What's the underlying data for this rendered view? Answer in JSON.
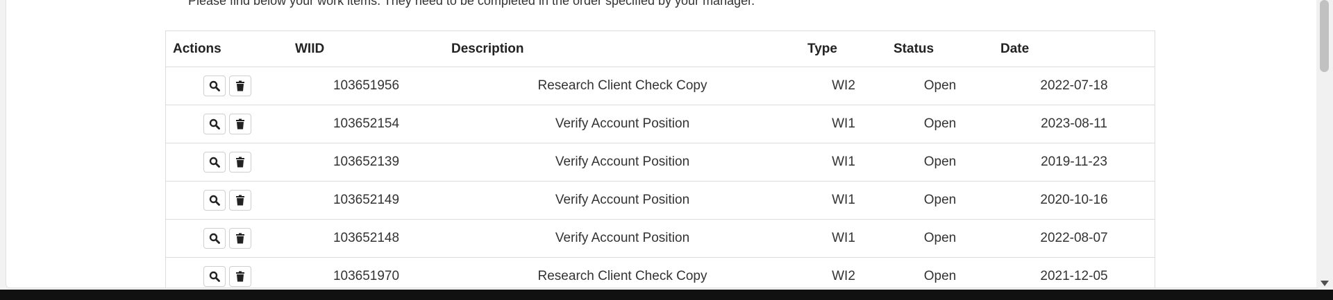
{
  "intro_text": "Please find below your work items. They need to be completed in the order specified by your manager.",
  "table": {
    "headers": [
      "Actions",
      "WIID",
      "Description",
      "Type",
      "Status",
      "Date"
    ],
    "rows": [
      {
        "wiid": "103651956",
        "description": "Research Client Check Copy",
        "type": "WI2",
        "status": "Open",
        "date": "2022-07-18"
      },
      {
        "wiid": "103652154",
        "description": "Verify Account Position",
        "type": "WI1",
        "status": "Open",
        "date": "2023-08-11"
      },
      {
        "wiid": "103652139",
        "description": "Verify Account Position",
        "type": "WI1",
        "status": "Open",
        "date": "2019-11-23"
      },
      {
        "wiid": "103652149",
        "description": "Verify Account Position",
        "type": "WI1",
        "status": "Open",
        "date": "2020-10-16"
      },
      {
        "wiid": "103652148",
        "description": "Verify Account Position",
        "type": "WI1",
        "status": "Open",
        "date": "2022-08-07"
      },
      {
        "wiid": "103651970",
        "description": "Research Client Check Copy",
        "type": "WI2",
        "status": "Open",
        "date": "2021-12-05"
      }
    ]
  },
  "icons": {
    "view": "search-icon",
    "delete": "trash-icon"
  }
}
